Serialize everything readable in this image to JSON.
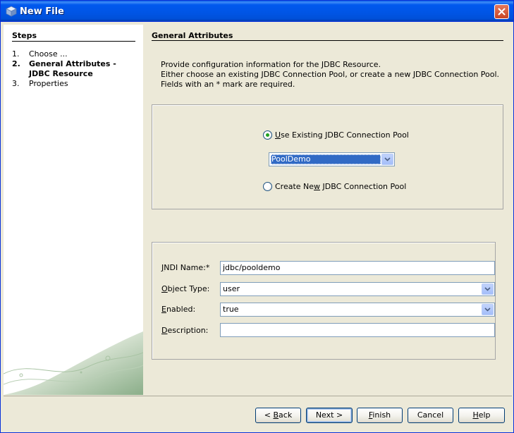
{
  "window": {
    "title": "New File"
  },
  "steps": {
    "title": "Steps",
    "items": [
      {
        "num": "1.",
        "label": "Choose ..."
      },
      {
        "num": "2.",
        "label": "General Attributes - JDBC Resource"
      },
      {
        "num": "3.",
        "label": "Properties"
      }
    ]
  },
  "main": {
    "title": "General Attributes",
    "description": [
      "Provide configuration information for the JDBC Resource.",
      "Either choose an existing JDBC Connection Pool, or create a new JDBC Connection Pool.",
      "Fields with an * mark are required."
    ]
  },
  "pool": {
    "use_existing_label_pre": "",
    "use_existing_label_u": "U",
    "use_existing_label_post": "se Existing JDBC Connection Pool",
    "selected_pool": "PoolDemo",
    "create_new_label_pre": "Create Ne",
    "create_new_label_u": "w",
    "create_new_label_post": " JDBC Connection Pool"
  },
  "form": {
    "jndi_label_u": "J",
    "jndi_label_post": "NDI Name:*",
    "jndi_value": "jdbc/pooldemo",
    "object_type_label_u": "O",
    "object_type_label_post": "bject Type:",
    "object_type_value": "user",
    "enabled_label_u": "E",
    "enabled_label_post": "nabled:",
    "enabled_value": "true",
    "description_label_u": "D",
    "description_label_post": "escription:",
    "description_value": ""
  },
  "buttons": {
    "back_pre": "< ",
    "back_u": "B",
    "back_post": "ack",
    "next": "Next >",
    "finish_u": "F",
    "finish_post": "inish",
    "cancel": "Cancel",
    "help_u": "H",
    "help_post": "elp"
  },
  "colors": {
    "titlebar": "#0055E5",
    "selection": "#316AC5",
    "close_button": "#C84525",
    "dialog_bg": "#ECE9D8"
  }
}
